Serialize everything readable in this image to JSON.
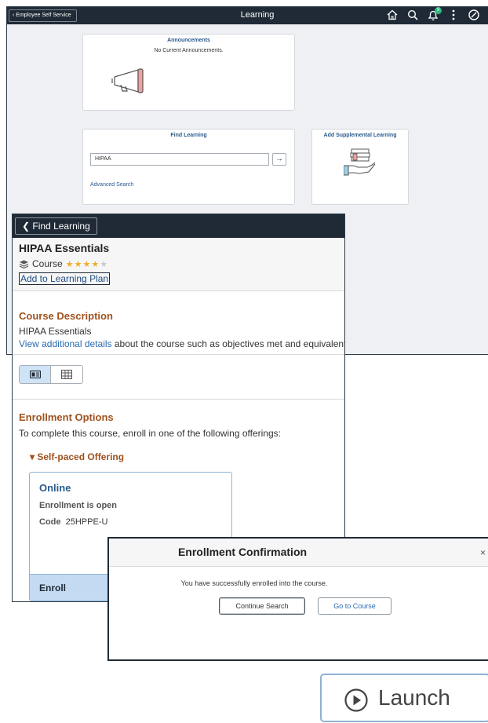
{
  "home": {
    "back_label": "Employee Self Service",
    "title": "Learning",
    "notification_count": "9",
    "announcements": {
      "title": "Announcements",
      "message": "No Current Announcements."
    },
    "find": {
      "title": "Find Learning",
      "value": "HIPAA",
      "advanced": "Advanced Search"
    },
    "supplemental": {
      "title": "Add Supplemental Learning"
    }
  },
  "course": {
    "back_label": "Find Learning",
    "title": "HIPAA Essentials",
    "type": "Course",
    "rating": 4,
    "rating_max": 5,
    "add_plan": "Add to Learning Plan",
    "description": {
      "heading": "Course Description",
      "text": "HIPAA Essentials",
      "link": "View additional details",
      "link_rest": " about the course such as objectives met and equivalents"
    },
    "enrollment": {
      "heading": "Enrollment Options",
      "intro": "To complete this course, enroll in one of the following offerings:",
      "offering_group": "Self-paced Offering",
      "card": {
        "title": "Online",
        "status": "Enrollment is open",
        "code_label": "Code",
        "code": "25HPPE-U",
        "enroll": "Enroll"
      }
    }
  },
  "modal": {
    "title": "Enrollment Confirmation",
    "close": "×",
    "message": "You have successfully enrolled into the course.",
    "continue": "Continue Search",
    "goto": "Go to Course"
  },
  "launch": {
    "label": "Launch"
  },
  "colors": {
    "header": "#1f2a36",
    "accent_orange": "#a0521f",
    "link_blue": "#2a6bb0",
    "star": "#f0ae2b"
  }
}
